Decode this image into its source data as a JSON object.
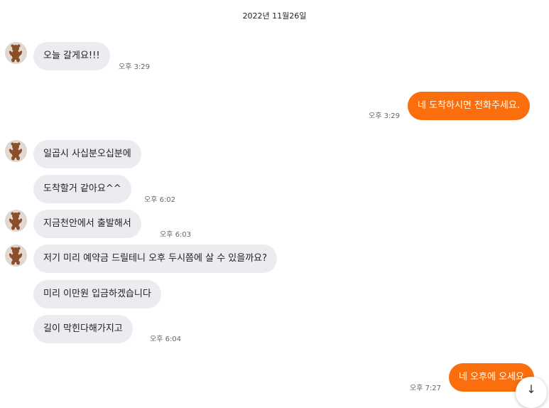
{
  "date_divider": "2022년 11월26일",
  "messages": [
    {
      "text": "오늘 갈게요!!!",
      "time": "오후 3:29"
    },
    {
      "text": "네 도착하시면 전화주세요.",
      "time": "오후 3:29"
    },
    {
      "text": "일곱시 사십분오십분에",
      "time": ""
    },
    {
      "text": "도착할거 같아요^^",
      "time": "오후 6:02"
    },
    {
      "text": "지금천안에서 출발해서",
      "time": "오후 6:03"
    },
    {
      "text": "저기 미리 예약금 드릴테니 오후 두시쯤에 살 수 있을까요?",
      "time": ""
    },
    {
      "text": "미리 이만원 입금하겠습니다",
      "time": ""
    },
    {
      "text": "길이 막힌다해가지고",
      "time": "오후 6:04"
    },
    {
      "text": "네 오후에 오세요",
      "time": "오후 7:27"
    }
  ],
  "icons": {
    "avatar": "teddy-bear-avatar-icon",
    "scroll": "arrow-down-icon"
  },
  "colors": {
    "outgoing": "#fb6e0d",
    "incoming": "#ececf0",
    "time": "#666666"
  }
}
